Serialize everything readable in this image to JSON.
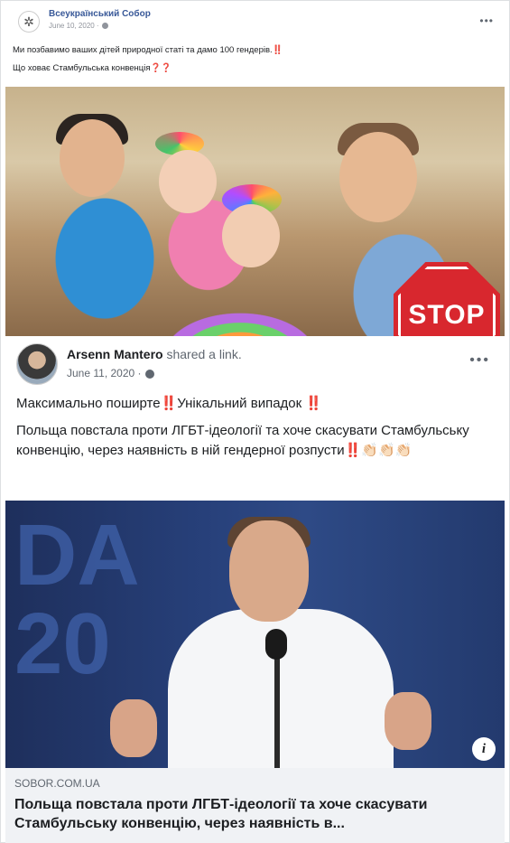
{
  "inner_post": {
    "page_name": "Всеукраїнський Собор",
    "date": "June 10, 2020 ·",
    "line1": "Ми позбавимо ваших дітей природної статі та дамо 100 гендерів.‼️",
    "line2": "Що ховає Стамбульська конвенція❓❓",
    "more_icon": "•••",
    "stop_sign_text": "STOP"
  },
  "share_post": {
    "author": "Arsenn Mantero",
    "action": "shared a link.",
    "date": "June 11, 2020 ·",
    "more_icon": "•••",
    "text_line1": "Максимально поширте‼️Унікальний випадок ‼️",
    "text_para": "Польща повстала проти ЛГБТ-ідеології та хоче скасувати Стамбульську конвенцію, через наявність в ній гендерної розпусти‼️👏🏻👏🏻👏🏻"
  },
  "photo2": {
    "backdrop_text_1": "DA",
    "backdrop_text_2": "20",
    "info_icon": "i"
  },
  "link_preview": {
    "domain": "SOBOR.COM.UA",
    "title": "Польща повстала проти ЛГБТ-ідеології та хоче скасувати Стамбульську конвенцію, через наявність в..."
  }
}
